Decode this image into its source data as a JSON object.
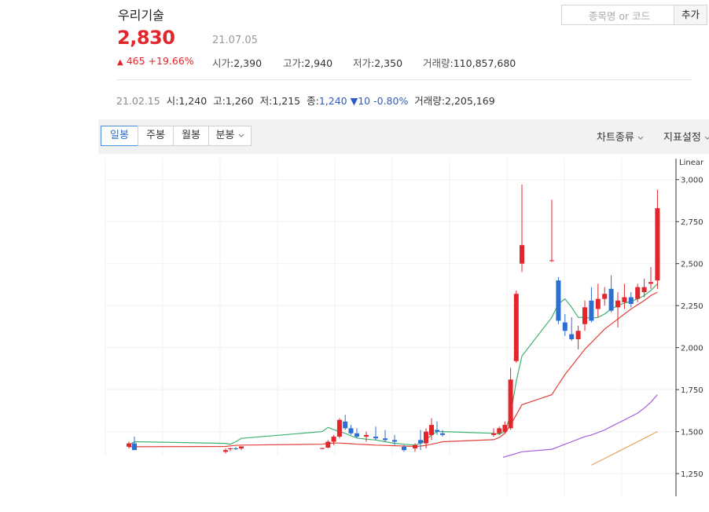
{
  "header": {
    "stock_name": "우리기술",
    "price": "2,830",
    "date": "21.07.05",
    "change_arrow": "▲",
    "change_amount": "465",
    "change_percent": "+19.66%",
    "ohlc": [
      {
        "key": "시가",
        "value": "2,390"
      },
      {
        "key": "고가",
        "value": "2,940"
      },
      {
        "key": "저가",
        "value": "2,350"
      },
      {
        "key": "거래량",
        "value": "110,857,680"
      }
    ]
  },
  "search": {
    "placeholder": "종목명 or 코드",
    "add_label": "추가"
  },
  "hover_info": {
    "date": "21.02.15",
    "open_key": "시",
    "open": "1,240",
    "high_key": "고",
    "high": "1,260",
    "low_key": "저",
    "low": "1,215",
    "close_key": "종",
    "close": "1,240",
    "change_arrow": "▼",
    "change": "10",
    "change_percent": "-0.80%",
    "volume_key": "거래량",
    "volume": "2,205,169"
  },
  "toolbar": {
    "periods": [
      "일봉",
      "주봉",
      "월봉",
      "분봉"
    ],
    "active_period": "일봉",
    "chart_type_label": "차트종류",
    "indicator_label": "지표설정"
  },
  "colors": {
    "up": "#e3252c",
    "down": "#2c6fd0",
    "ma5": "#3cb371",
    "ma20": "#e0413a",
    "ma60": "#a35fd8",
    "ma120": "#e8a25a"
  },
  "chart_data": {
    "type": "candlestick",
    "scale_label": "Linear",
    "y_ticks": [
      "3,000",
      "2,750",
      "2,500",
      "2,250",
      "2,000",
      "1,750",
      "1,500",
      "1,250"
    ],
    "y_tick_values": [
      3000,
      2750,
      2500,
      2250,
      2000,
      1750,
      1500,
      1250
    ],
    "ylim": [
      1115,
      3125
    ],
    "candles": [
      [
        1410,
        1440,
        1400,
        1430
      ],
      [
        1430,
        1470,
        1420,
        1390
      ],
      [
        1380,
        1400,
        1370,
        1390
      ],
      [
        1395,
        1405,
        1385,
        1400
      ],
      [
        1400,
        1410,
        1390,
        1398
      ],
      [
        1400,
        1410,
        1390,
        1412
      ],
      [
        1400,
        1405,
        1395,
        1402
      ],
      [
        1405,
        1450,
        1400,
        1440
      ],
      [
        1440,
        1480,
        1420,
        1470
      ],
      [
        1470,
        1580,
        1460,
        1570
      ],
      [
        1560,
        1600,
        1510,
        1520
      ],
      [
        1520,
        1540,
        1480,
        1490
      ],
      [
        1490,
        1520,
        1460,
        1470
      ],
      [
        1470,
        1500,
        1440,
        1480
      ],
      [
        1470,
        1530,
        1450,
        1460
      ],
      [
        1460,
        1510,
        1440,
        1450
      ],
      [
        1450,
        1480,
        1420,
        1440
      ],
      [
        1410,
        1420,
        1380,
        1390
      ],
      [
        1400,
        1430,
        1380,
        1420
      ],
      [
        1450,
        1510,
        1390,
        1430
      ],
      [
        1430,
        1520,
        1400,
        1500
      ],
      [
        1480,
        1580,
        1450,
        1540
      ],
      [
        1510,
        1560,
        1480,
        1500
      ],
      [
        1490,
        1510,
        1470,
        1480
      ],
      [
        1480,
        1520,
        1470,
        1490
      ],
      [
        1490,
        1530,
        1480,
        1520
      ],
      [
        1500,
        1560,
        1490,
        1540
      ],
      [
        1520,
        1880,
        1510,
        1810
      ],
      [
        1920,
        2340,
        1910,
        2320
      ],
      [
        2500,
        2970,
        2450,
        2610
      ],
      [
        2520,
        2880,
        2510,
        2520
      ],
      [
        2400,
        2420,
        2140,
        2160
      ],
      [
        2150,
        2200,
        2070,
        2100
      ],
      [
        2080,
        2180,
        2040,
        2050
      ],
      [
        2050,
        2130,
        1990,
        2100
      ],
      [
        2140,
        2280,
        2100,
        2240
      ],
      [
        2280,
        2360,
        2150,
        2160
      ],
      [
        2230,
        2380,
        2180,
        2290
      ],
      [
        2290,
        2360,
        2250,
        2320
      ],
      [
        2350,
        2430,
        2210,
        2220
      ],
      [
        2240,
        2330,
        2120,
        2280
      ],
      [
        2270,
        2380,
        2230,
        2300
      ],
      [
        2300,
        2330,
        2240,
        2260
      ],
      [
        2290,
        2380,
        2270,
        2360
      ],
      [
        2330,
        2410,
        2300,
        2360
      ],
      [
        2380,
        2480,
        2350,
        2390
      ],
      [
        2400,
        2940,
        2350,
        2830
      ]
    ],
    "ma5": [
      1420,
      1440,
      1430,
      1425,
      1440,
      1460,
      1500,
      1525,
      1512,
      1500,
      1490,
      1475,
      1462,
      1455,
      1450,
      1440,
      1430,
      1425,
      1420,
      1430,
      1450,
      1480,
      1500,
      1500,
      1490,
      1485,
      1500,
      1600,
      1800,
      1950,
      2180,
      2260,
      2290,
      2240,
      2180,
      2180,
      2175,
      2180,
      2200,
      2230,
      2250,
      2265,
      2275,
      2290,
      2310,
      2340,
      2380
    ],
    "ma20": [
      1410,
      1410,
      1412,
      1415,
      1418,
      1420,
      1425,
      1430,
      1432,
      1432,
      1430,
      1428,
      1425,
      1423,
      1420,
      1418,
      1416,
      1414,
      1412,
      1414,
      1418,
      1425,
      1432,
      1440,
      1452,
      1465,
      1490,
      1540,
      1600,
      1660,
      1720,
      1780,
      1840,
      1890,
      1940,
      1990,
      2030,
      2070,
      2110,
      2140,
      2170,
      2200,
      2230,
      2255,
      2280,
      2310,
      2330
    ],
    "ma60": [
      1300,
      1310,
      1320,
      1330,
      1340,
      1350,
      1360,
      1370,
      1380,
      1395,
      1410,
      1425,
      1440,
      1455,
      1470,
      1480,
      1495,
      1510,
      1530,
      1550,
      1570,
      1590,
      1610,
      1640,
      1675,
      1720
    ],
    "ma120": [
      1300,
      1320,
      1340,
      1360,
      1380,
      1400,
      1420,
      1440,
      1460,
      1480,
      1500
    ]
  }
}
